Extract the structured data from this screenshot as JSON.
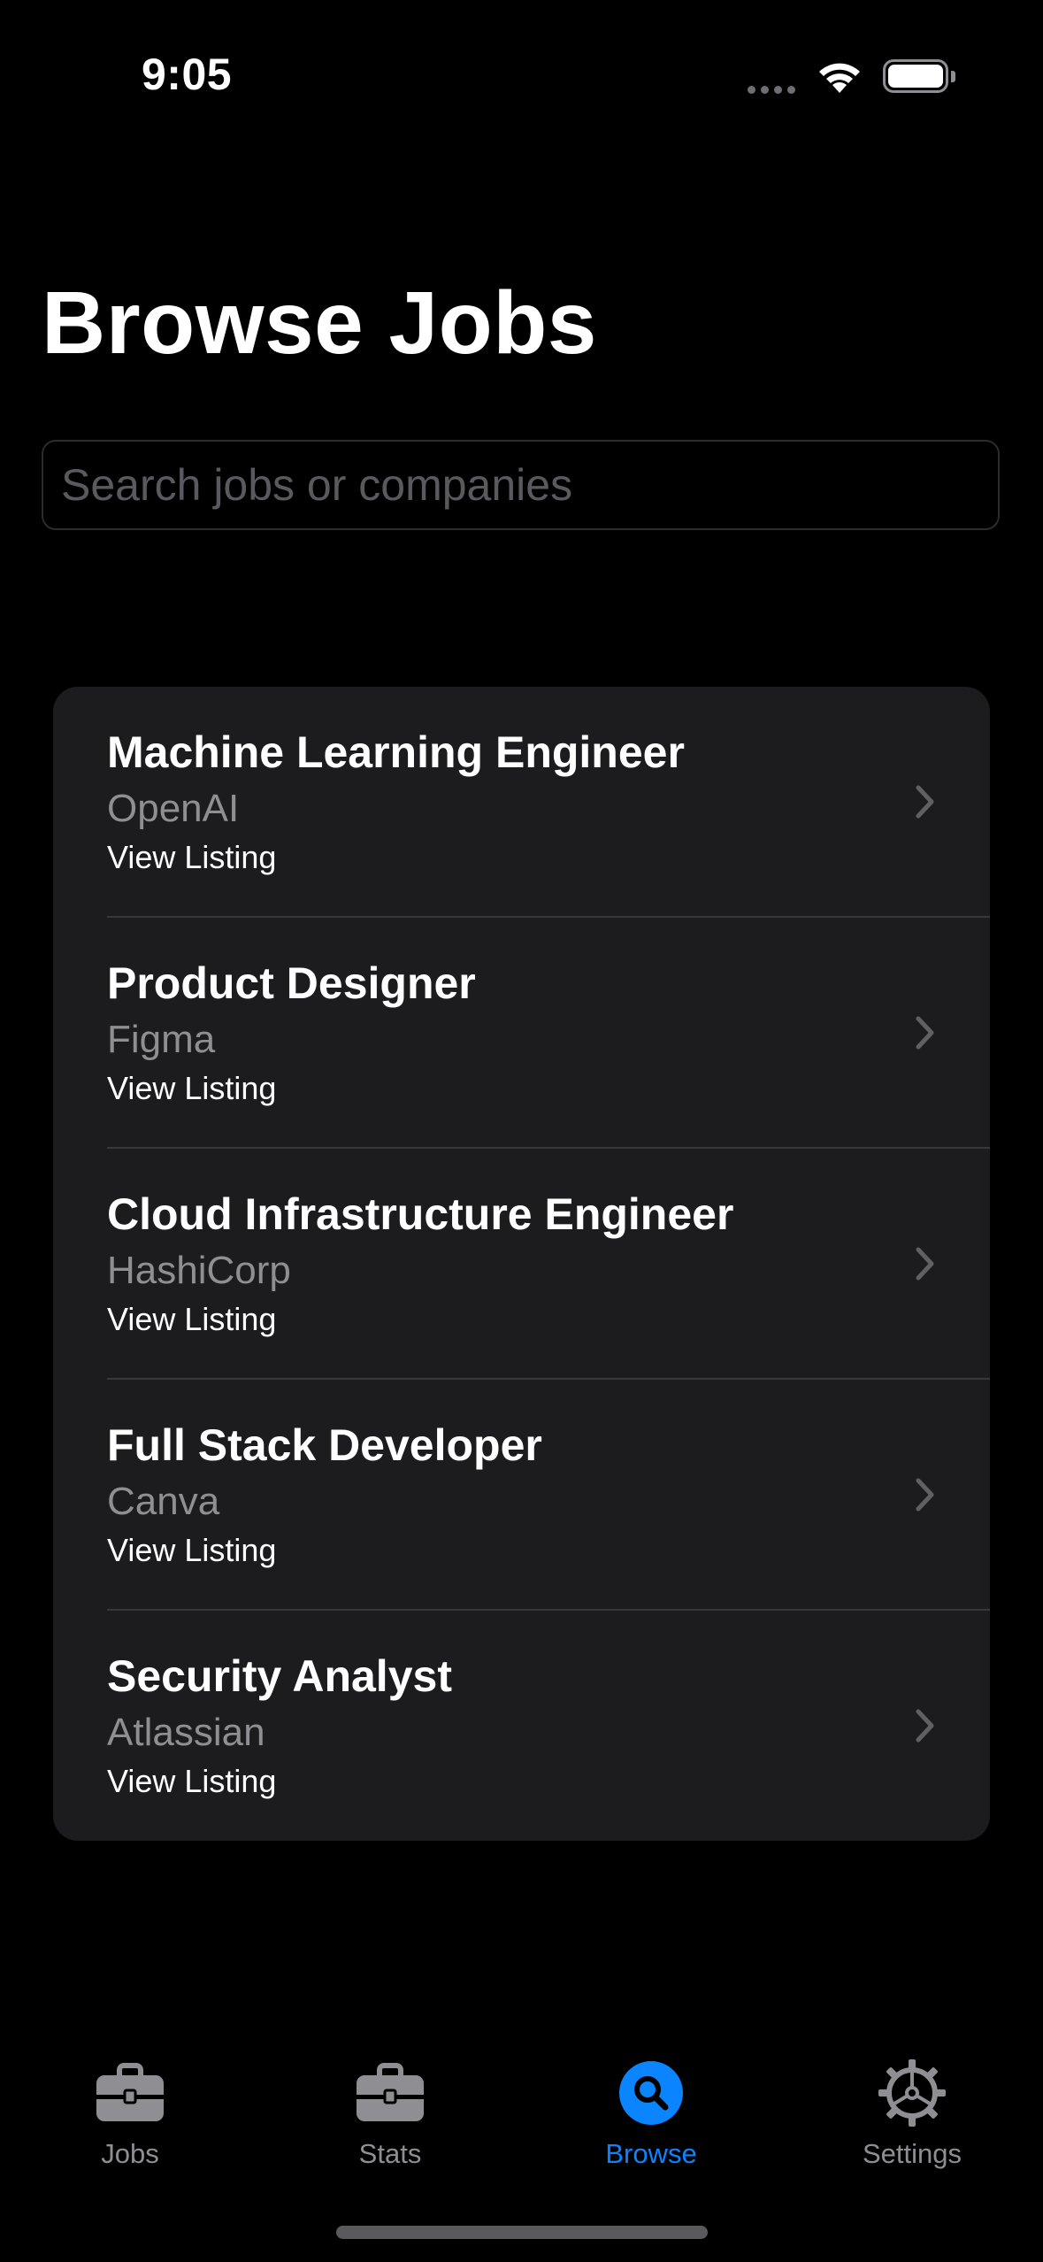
{
  "status_bar": {
    "time": "9:05"
  },
  "page": {
    "title": "Browse Jobs"
  },
  "search": {
    "value": "",
    "placeholder": "Search jobs or companies"
  },
  "jobs": [
    {
      "title": "Machine Learning Engineer",
      "company": "OpenAI",
      "link_label": "View Listing"
    },
    {
      "title": "Product Designer",
      "company": "Figma",
      "link_label": "View Listing"
    },
    {
      "title": "Cloud Infrastructure Engineer",
      "company": "HashiCorp",
      "link_label": "View Listing"
    },
    {
      "title": "Full Stack Developer",
      "company": "Canva",
      "link_label": "View Listing"
    },
    {
      "title": "Security Analyst",
      "company": "Atlassian",
      "link_label": "View Listing"
    }
  ],
  "tabs": [
    {
      "label": "Jobs",
      "icon": "briefcase-icon",
      "active": false
    },
    {
      "label": "Stats",
      "icon": "briefcase-icon",
      "active": false
    },
    {
      "label": "Browse",
      "icon": "search-icon",
      "active": true
    },
    {
      "label": "Settings",
      "icon": "gear-icon",
      "active": false
    }
  ],
  "colors": {
    "background": "#000000",
    "card": "#1c1c1e",
    "accent": "#0a84ff",
    "secondary_text": "#8e8e93",
    "inactive_icon": "#8e8e93"
  }
}
